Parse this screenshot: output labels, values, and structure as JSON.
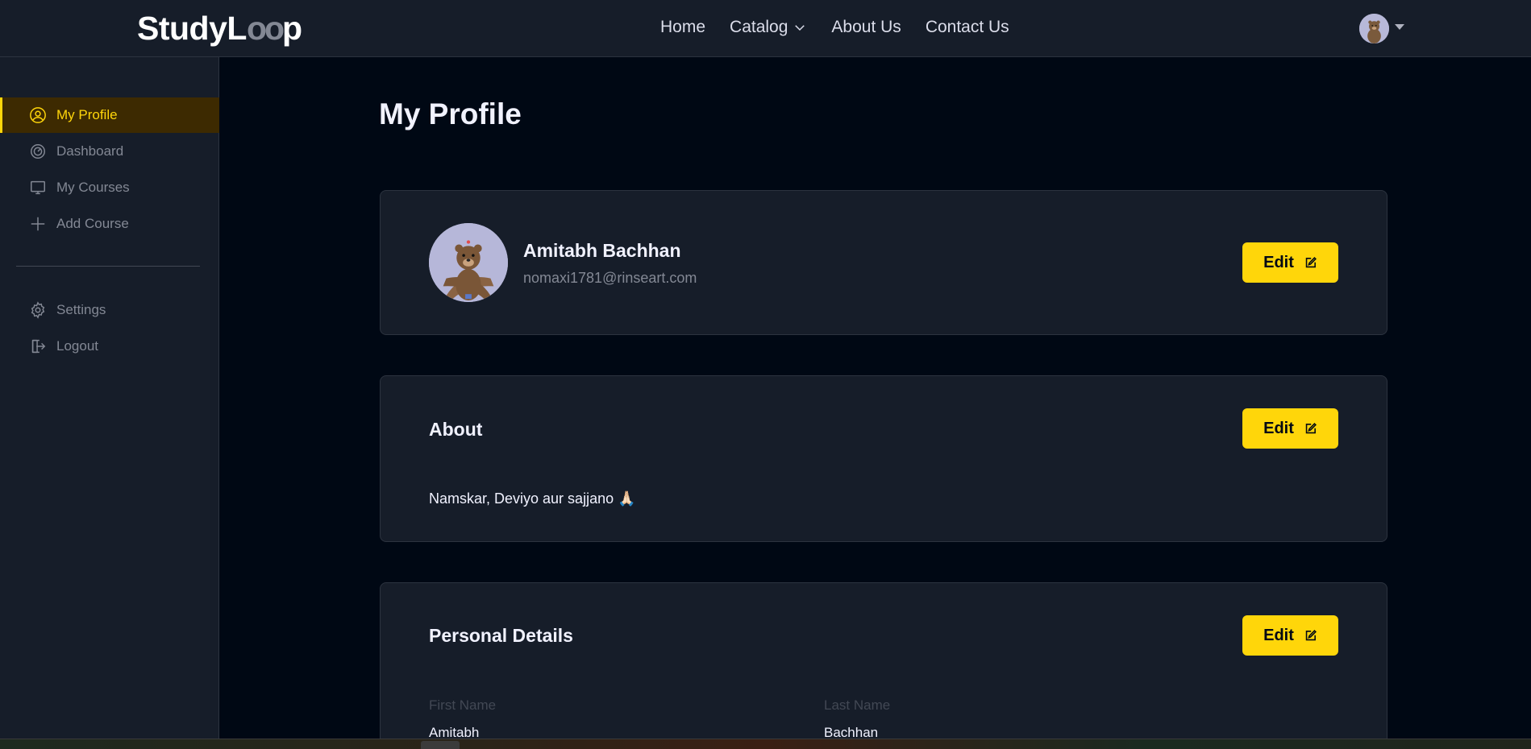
{
  "brand": {
    "logo_prefix": "StudyL",
    "logo_oo": "oo",
    "logo_suffix": "p"
  },
  "nav": {
    "links": [
      {
        "label": "Home"
      },
      {
        "label": "Catalog"
      },
      {
        "label": "About Us"
      },
      {
        "label": "Contact Us"
      }
    ]
  },
  "sidebar": {
    "items": [
      {
        "label": "My Profile",
        "icon": "user-circle-icon",
        "active": true
      },
      {
        "label": "Dashboard",
        "icon": "gauge-icon"
      },
      {
        "label": "My Courses",
        "icon": "monitor-icon"
      },
      {
        "label": "Add Course",
        "icon": "plus-icon"
      },
      {
        "label": "Settings",
        "icon": "gear-icon"
      },
      {
        "label": "Logout",
        "icon": "logout-icon"
      }
    ]
  },
  "main": {
    "title": "My Profile",
    "profile": {
      "name": "Amitabh Bachhan",
      "email": "nomaxi1781@rinseart.com",
      "edit_label": "Edit"
    },
    "about": {
      "heading": "About",
      "text": "Namskar, Deviyo aur sajjano 🙏🏻",
      "edit_label": "Edit"
    },
    "personal": {
      "heading": "Personal Details",
      "edit_label": "Edit",
      "first_name_label": "First Name",
      "first_name_value": "Amitabh",
      "last_name_label": "Last Name",
      "last_name_value": "Bachhan"
    }
  },
  "colors": {
    "accent": "#ffd60a",
    "background": "#000814",
    "panel": "#161d29"
  }
}
